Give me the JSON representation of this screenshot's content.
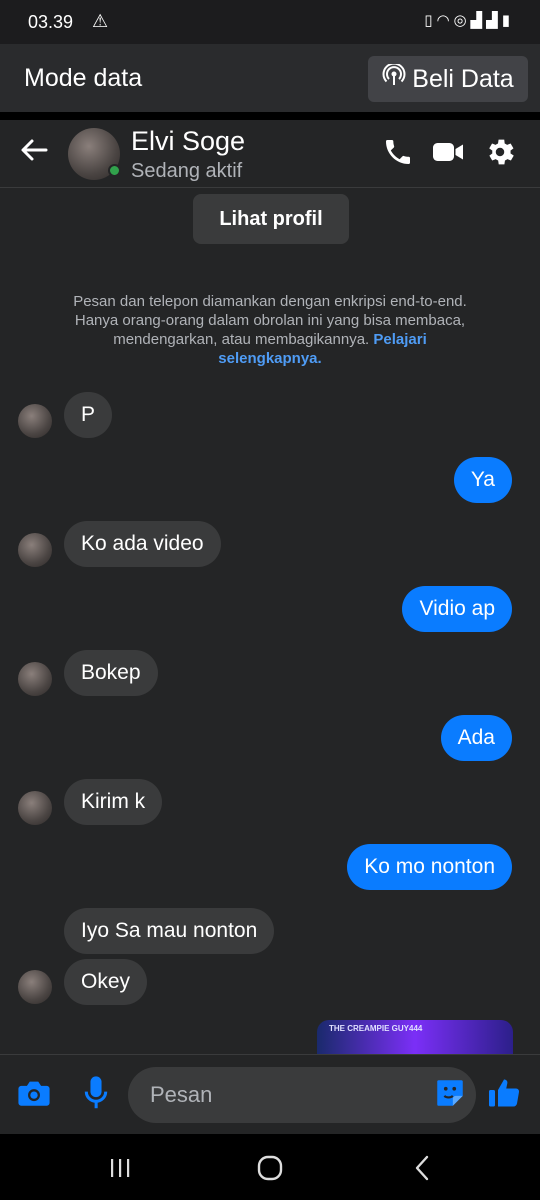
{
  "status_bar": {
    "time": "03.39",
    "warning_icon": "warning-icon",
    "icons": [
      "vibrate-icon",
      "wifi-icon",
      "hotspot-icon",
      "signal-icon",
      "signal-icon",
      "battery-icon"
    ]
  },
  "data_bar": {
    "title": "Mode data",
    "buy_label": "Beli Data",
    "buy_icon": "broadcast-icon"
  },
  "header": {
    "contact_name": "Elvi Soge",
    "contact_status": "Sedang aktif",
    "icons": [
      "back-arrow-icon",
      "phone-icon",
      "video-camera-icon",
      "gear-icon"
    ]
  },
  "conversation": {
    "profile_button": "Lihat profil",
    "encryption_note": "Pesan dan telepon diamankan dengan enkripsi end-to-end. Hanya orang-orang dalam obrolan ini yang bisa membaca, mendengarkan, atau membagikannya.",
    "encryption_link": "Pelajari selengkapnya.",
    "messages": [
      {
        "from": "them",
        "text": "P"
      },
      {
        "from": "me",
        "text": "Ya"
      },
      {
        "from": "them",
        "text": "Ko ada video"
      },
      {
        "from": "me",
        "text": "Vidio ap"
      },
      {
        "from": "them",
        "text": "Bokep"
      },
      {
        "from": "me",
        "text": "Ada"
      },
      {
        "from": "them",
        "text": "Kirim k"
      },
      {
        "from": "me",
        "text": "Ko mo nonton"
      },
      {
        "from": "them",
        "text": "Iyo Sa mau nonton"
      },
      {
        "from": "them",
        "text": "Okey"
      }
    ],
    "video_thumb_text": "THE CREAMPIE GUY444"
  },
  "composer": {
    "placeholder": "Pesan",
    "icons": [
      "camera-icon",
      "microphone-icon",
      "sticker-icon",
      "thumbs-up-icon"
    ]
  },
  "nav_bar": {
    "icons": [
      "recent-apps-icon",
      "home-icon",
      "back-icon"
    ]
  },
  "colors": {
    "background": "#242526",
    "incoming_bubble": "#3a3b3c",
    "outgoing_bubble": "#0a7cff",
    "accent": "#0a7cff",
    "link": "#4f9cf5",
    "online": "#31a24c"
  }
}
